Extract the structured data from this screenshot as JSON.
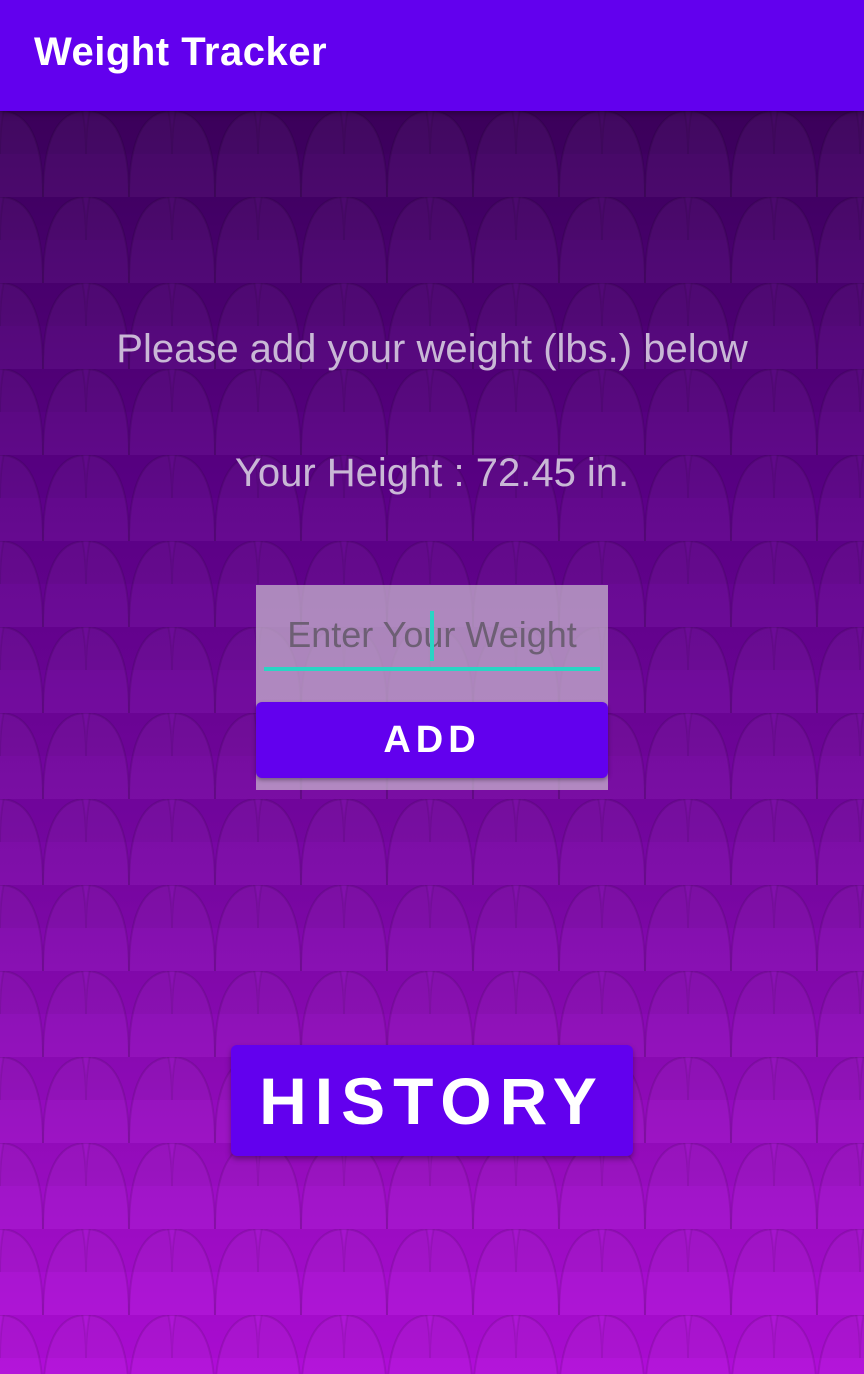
{
  "app_bar": {
    "title": "Weight Tracker"
  },
  "main": {
    "prompt_text": "Please add your weight (lbs.) below",
    "height_text": "Your Height : 72.45 in.",
    "weight_input": {
      "value": "",
      "placeholder": "Enter Your Weight"
    },
    "add_button_label": "ADD",
    "history_button_label": "HISTORY"
  },
  "colors": {
    "primary": "#6200ee",
    "accent": "#2ad4c4",
    "background_top": "#3d005e",
    "background_bottom": "#b10cd9"
  }
}
